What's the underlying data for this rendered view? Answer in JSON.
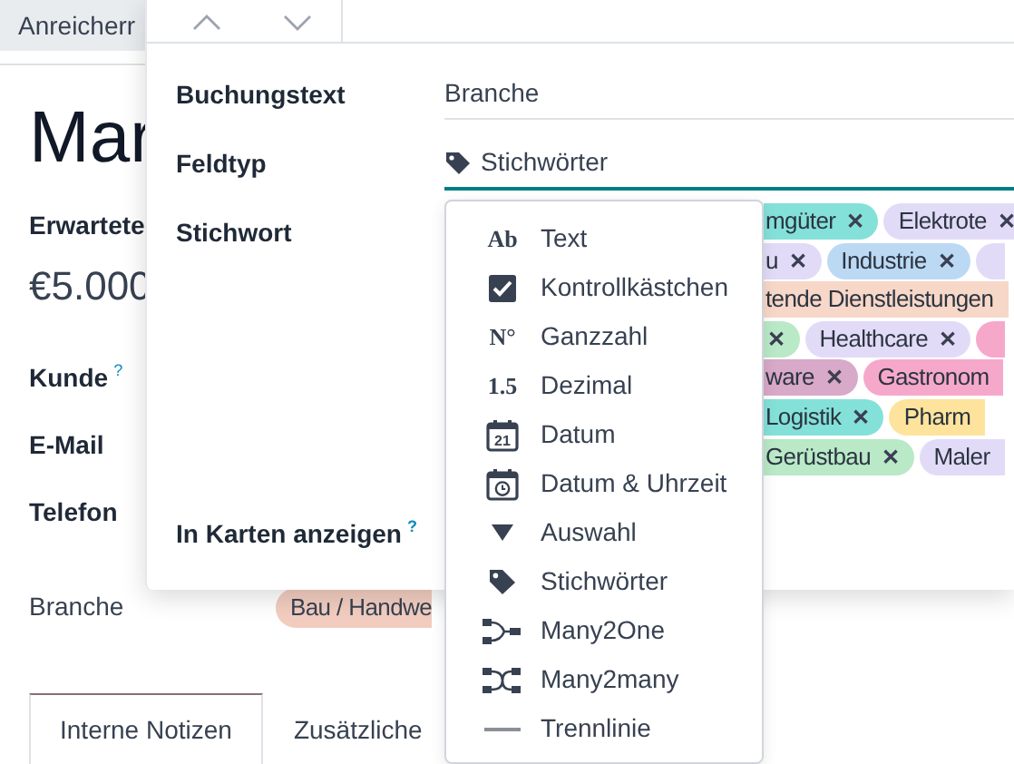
{
  "top_tab": {
    "label": "Anreicherr"
  },
  "record": {
    "title": "Mar",
    "expected_label": "Erwartete",
    "amount": "€5.000",
    "fields": [
      {
        "label": "Kunde",
        "help": "?"
      },
      {
        "label": "E-Mail"
      },
      {
        "label": "Telefon"
      }
    ],
    "branche": {
      "label": "Branche",
      "tag": "Bau / Handwe",
      "color": "#f2cdbf"
    },
    "tabs": [
      {
        "label": "Interne Notizen",
        "selected": true
      },
      {
        "label": "Zusätzliche",
        "selected": false
      }
    ]
  },
  "popover": {
    "rows": [
      {
        "kind": "text",
        "label": "Buchungstext",
        "value": "Branche"
      },
      {
        "kind": "type",
        "label": "Feldtyp",
        "value": "Stichwörter"
      },
      {
        "kind": "tags",
        "label": "Stichwort"
      },
      {
        "kind": "toggle",
        "label": "In Karten anzeigen",
        "help": "?"
      }
    ],
    "tag_rows": [
      [
        {
          "label": "mgüter",
          "color": "#84e1d9"
        },
        {
          "label": "Elektrote",
          "color": "#e2dbf8"
        }
      ],
      [
        {
          "label": "u",
          "color": "#e2dbf8"
        },
        {
          "label": "Industrie",
          "color": "#bcd9f4"
        },
        {
          "color": "#e2dbf8",
          "cut": true
        }
      ],
      [
        {
          "label": "tende Dienstleistungen",
          "color": "#f7d7c8",
          "cut": true
        }
      ],
      [
        {
          "color": "#b9e9c7"
        },
        {
          "label": "Healthcare",
          "color": "#e2dbf8"
        },
        {
          "color": "#f6a8cb",
          "cut": true
        }
      ],
      [
        {
          "label": "ware",
          "color": "#d8a9c8"
        },
        {
          "label": "Gastronom",
          "color": "#f6a8cb",
          "cut": true
        }
      ],
      [
        {
          "label": "Logistik",
          "color": "#84e1d9"
        },
        {
          "label": "Pharm",
          "color": "#fde39c",
          "cut": true
        }
      ],
      [
        {
          "label": "Gerüstbau",
          "color": "#b9e9c7"
        },
        {
          "label": "Maler",
          "color": "#e2dbf8",
          "cut": true
        }
      ]
    ],
    "remove_glyph": "✕"
  },
  "type_menu": [
    {
      "kind": "text",
      "glyph": "Ab",
      "label": "Text",
      "selected": false
    },
    {
      "kind": "checkbox",
      "label": "Kontrollkästchen",
      "selected": false
    },
    {
      "kind": "text",
      "glyph": "N°",
      "label": "Ganzzahl",
      "selected": false
    },
    {
      "kind": "text",
      "glyph": "1.5",
      "label": "Dezimal",
      "selected": false
    },
    {
      "kind": "date",
      "glyph": "21",
      "label": "Datum",
      "selected": false
    },
    {
      "kind": "datetime",
      "label": "Datum & Uhrzeit",
      "selected": false
    },
    {
      "kind": "selection",
      "label": "Auswahl",
      "selected": false
    },
    {
      "kind": "tags",
      "label": "Stichwörter",
      "selected": false
    },
    {
      "kind": "many2one",
      "label": "Many2One",
      "selected": false
    },
    {
      "kind": "many2many",
      "label": "Many2many",
      "selected": false
    },
    {
      "kind": "separator",
      "label": "Trennlinie",
      "selected": false
    }
  ]
}
